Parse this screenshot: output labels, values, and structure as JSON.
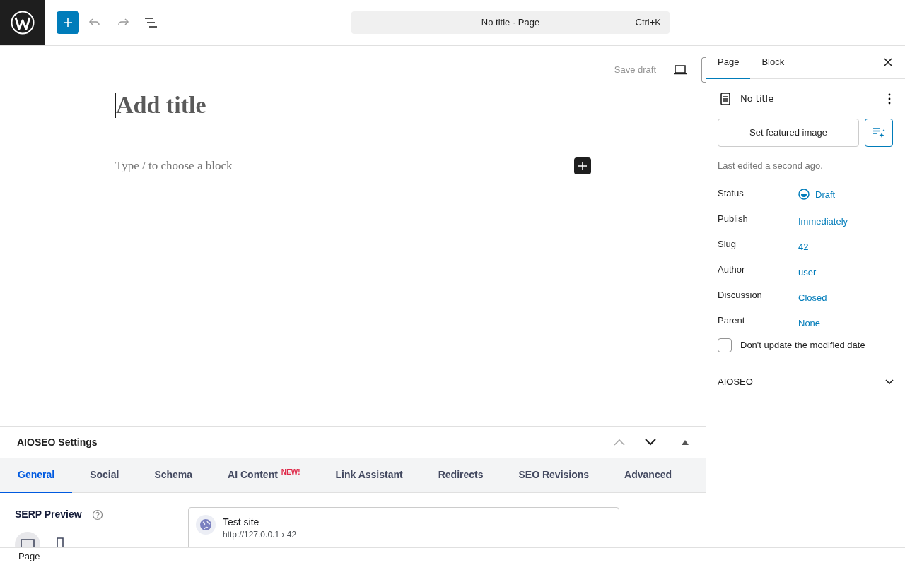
{
  "toolbar": {
    "document_title": "No title · Page",
    "shortcut": "Ctrl+K"
  },
  "editor": {
    "save_draft": "Save draft",
    "title_placeholder": "Add title",
    "block_placeholder": "Type / to choose a block"
  },
  "sidebar": {
    "tabs": [
      {
        "label": "Page",
        "selected": true
      },
      {
        "label": "Block",
        "selected": false
      }
    ],
    "document": {
      "title": "No title"
    },
    "featured_image_button": "Set featured image",
    "last_edited": "Last edited a second ago.",
    "fields": [
      {
        "label": "Status",
        "value": "Draft",
        "kind": "status"
      },
      {
        "label": "Publish",
        "value": "Immediately",
        "kind": "link"
      },
      {
        "label": "Slug",
        "value": "42",
        "kind": "link"
      },
      {
        "label": "Author",
        "value": "user",
        "kind": "link"
      },
      {
        "label": "Discussion",
        "value": "Closed",
        "kind": "link"
      },
      {
        "label": "Parent",
        "value": "None",
        "kind": "link"
      }
    ],
    "modified_date_checkbox": {
      "label": "Don't update the modified date",
      "checked": false
    },
    "panels": [
      {
        "title": "AIOSEO",
        "expanded": false
      }
    ]
  },
  "aioseo": {
    "title": "AIOSEO Settings",
    "tabs": [
      {
        "label": "General",
        "selected": true
      },
      {
        "label": "Social",
        "selected": false
      },
      {
        "label": "Schema",
        "selected": false
      },
      {
        "label": "AI Content",
        "badge": "NEW!",
        "selected": false
      },
      {
        "label": "Link Assistant",
        "selected": false
      },
      {
        "label": "Redirects",
        "selected": false
      },
      {
        "label": "SEO Revisions",
        "selected": false
      },
      {
        "label": "Advanced",
        "selected": false
      }
    ],
    "serp_preview": {
      "heading": "SERP Preview",
      "device_toggles": [
        {
          "kind": "desktop",
          "selected": true
        },
        {
          "kind": "mobile",
          "selected": false
        }
      ],
      "site_name": "Test site",
      "url": "http://127.0.0.1 › 42"
    }
  },
  "footer": {
    "breadcrumb": "Page"
  }
}
